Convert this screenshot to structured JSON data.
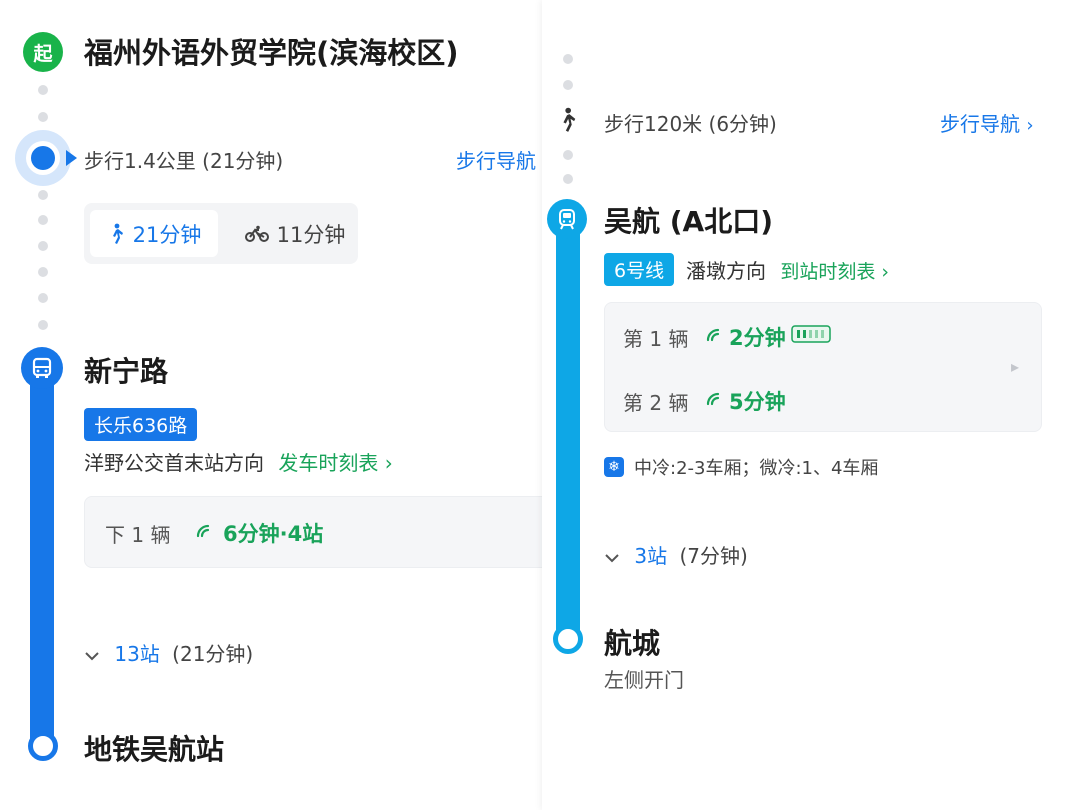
{
  "left": {
    "start": {
      "badge": "起",
      "title": "福州外语外贸学院(滨海校区)"
    },
    "walk": {
      "text": "步行1.4公里 (21分钟)",
      "nav_label": "步行导航"
    },
    "modes": {
      "walk_label": "21分钟",
      "bike_label": "11分钟"
    },
    "bus_stop": {
      "name": "新宁路",
      "route": "长乐636路",
      "direction": "洋野公交首末站方向",
      "schedule_link": "发车时刻表",
      "schedule_chevron": "›",
      "vehicle": {
        "label": "下 1 辆",
        "eta": "6分钟·4站"
      },
      "stops": {
        "count": "13站",
        "duration": "(21分钟)"
      }
    },
    "end_stop": {
      "name": "地铁吴航站"
    }
  },
  "right": {
    "walk": {
      "text": "步行120米 (6分钟)",
      "nav_label": "步行导航",
      "nav_chevron": "›"
    },
    "metro_stop": {
      "name": "吴航 (A北口)",
      "line": "6号线",
      "direction": "潘墩方向",
      "schedule_link": "到站时刻表",
      "schedule_chevron": "›",
      "trains": [
        {
          "label": "第 1 辆",
          "eta": "2分钟"
        },
        {
          "label": "第 2 辆",
          "eta": "5分钟"
        }
      ],
      "ac_info": "中冷:2-3车厢；微冷:1、4车厢",
      "stops": {
        "count": "3站",
        "duration": "(7分钟)"
      }
    },
    "end_stop": {
      "name": "航城",
      "door_side": "左侧开门"
    }
  },
  "colors": {
    "bus_blue": "#1777e8",
    "metro_cyan": "#0ea7e6",
    "start_green": "#19b34a",
    "eta_green": "#19a35a"
  },
  "icons": {
    "walk": "walking-person-icon",
    "bike": "bicycle-icon",
    "bus": "bus-icon",
    "metro": "metro-icon",
    "realtime": "realtime-signal-icon",
    "crowd": "crowding-level-icon",
    "ac": "snowflake-icon"
  }
}
